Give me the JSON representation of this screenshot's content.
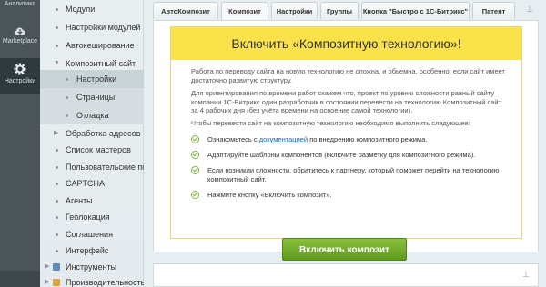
{
  "rail": {
    "analytics": "Аналитика",
    "marketplace": "Marketplace",
    "settings": "Настройки"
  },
  "tree": {
    "items": [
      {
        "label": "Модули"
      },
      {
        "label": "Настройки модулей"
      },
      {
        "label": "Автокеширование"
      },
      {
        "label": "Композитный сайт"
      },
      {
        "label": "Настройки"
      },
      {
        "label": "Страницы"
      },
      {
        "label": "Отладка"
      },
      {
        "label": "Обработка адресов"
      },
      {
        "label": "Список мастеров"
      },
      {
        "label": "Пользовательские поля"
      },
      {
        "label": "CAPTCHA"
      },
      {
        "label": "Агенты"
      },
      {
        "label": "Геолокация"
      },
      {
        "label": "Соглашения"
      },
      {
        "label": "Интерфейс"
      },
      {
        "label": "Инструменты"
      },
      {
        "label": "Производительность"
      }
    ]
  },
  "tabs": [
    {
      "label": "АвтоКомпозит"
    },
    {
      "label": "Композит"
    },
    {
      "label": "Настройки"
    },
    {
      "label": "Группы"
    },
    {
      "label": "Кнопка \"Быстро с 1С-Битрикс\""
    },
    {
      "label": "Патент"
    }
  ],
  "notice": {
    "title": "Включить «Композитную технологию»!",
    "p1": "Работа по переводу сайта на новую технологию не сложна, и обьемна, особенно, если сайт имеет достаточно развитую структуру.",
    "p2": "Для ориентирования по времени работ скажем что, проект по уровню сложности равный сайту компании 1С-Битрикс один разработчик в состоянии перевести на технологию Композитный сайт за 4 рабочих дня (без учёта времени на освоение самой технологии).",
    "p3": "Чтобы перевести сайт на композитную технологию необходимо выполнить следующее:",
    "steps": [
      {
        "pre": "Ознакомьтесь с ",
        "link": "документацией",
        "post": " по внедрению композитного режима."
      },
      {
        "text": "Адаптируйте шаблоны компонентов (включите разметку для композитного режима)."
      },
      {
        "text": "Если возникли сложности, обратитесь к партнеру, который поможет перейти на технологию композитный сайт."
      },
      {
        "text": "Нажмите кнопку «Включить композит»."
      }
    ]
  },
  "button": {
    "label": "Включить композит"
  },
  "colors": {
    "accent_green": "#6fae2a",
    "notice_yellow": "#fce24a",
    "rail_dark": "#4b5559"
  }
}
